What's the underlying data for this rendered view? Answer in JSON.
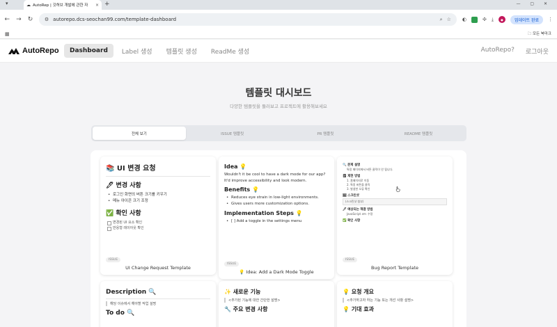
{
  "browser": {
    "tab_title": "AutoRep | 깃허브 개발에 관한 자",
    "url": "autorepo.dcs-seochan99.com/template-dashboard",
    "update_label": "업데이트 완료",
    "all_bookmarks": "모든 북마크"
  },
  "site": {
    "logo_text": "AutoRepo",
    "nav": [
      "Dashboard",
      "Label 생성",
      "템플릿 생성",
      "ReadMe 생성"
    ],
    "right_nav": [
      "AutoRepo?",
      "로그아웃"
    ]
  },
  "page": {
    "title": "템플릿 대시보드",
    "subtitle": "다양한 템플릿을 둘러보고 프로젝트에 활용해보세요"
  },
  "filters": [
    "전체 보기",
    "ISSUE 템플릿",
    "PR 템플릿",
    "README 템플릿"
  ],
  "cards": {
    "c1": {
      "h1": "📚 UI 변경 요청",
      "h2": "🖊 변경 사항",
      "items": [
        "로그인 화면의 버튼 크기를 키우기",
        "메뉴 아이콘 크기 조정"
      ],
      "h3": "✅ 확인 사항",
      "checks": [
        "변경된 UI 요소 확인",
        "반응형 레이아웃 확인"
      ],
      "tag": "ISSUE",
      "name": "UI Change Request Template"
    },
    "c2": {
      "h1": "Idea 💡",
      "p1": "Wouldn't it be cool to have a dark mode for our app? It'd improve accessibility and look modern.",
      "h2": "Benefits 💡",
      "items": [
        "Reduces eye strain in low-light environments.",
        "Gives users more customization options."
      ],
      "h3": "Implementation Steps 💡",
      "step": "[ ] Add a toggle in the settings menu",
      "tag": "ISSUE",
      "name": "💡 Idea: Add a Dark Mode Toggle"
    },
    "c3": {
      "s1": "🔍 문제 설명",
      "s1t": "특정 페이지에서 버튼 클릭이 안 됩니다.",
      "s2": "🗒 재현 방법",
      "s2items": [
        "1. 홈페이지로 이동",
        "2. 특정 버튼을 클릭",
        "3. 발생한 오류 확인"
      ],
      "s3": "🖼 스크린샷",
      "s3t": "(스크린샷 첨부)",
      "s4": "🖊 예상되는 해결 방법",
      "s4t": "JavaScript 코드 수정",
      "s5": "✅ 확인 사항",
      "tag": "ISSUE",
      "name": "Bug Report Template"
    },
    "c4": {
      "h1": "Description 🔍",
      "quote": "해당 이슈에서 해야할 작업 설명",
      "h2": "To do 🔍"
    },
    "c5": {
      "h1": "✨ 새로운 기능",
      "quote": "<추가된 기능에 대한 간단한 설명>",
      "h2": "🔧 주요 변경 사항"
    },
    "c6": {
      "h1": "💡 요청 개요",
      "quote": "<추가하고자 하는 기능 또는 개선 사항 설명>",
      "h2": "💡 기대 효과"
    }
  }
}
